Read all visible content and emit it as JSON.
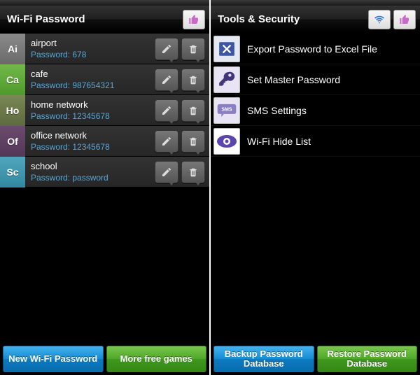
{
  "screen1": {
    "title": "Wi-Fi Password",
    "items": [
      {
        "badge": "Ai",
        "name": "airport",
        "password": "Password: 678",
        "color": "bg-gray"
      },
      {
        "badge": "Ca",
        "name": "cafe",
        "password": "Password: 987654321",
        "color": "bg-green"
      },
      {
        "badge": "Ho",
        "name": "home network",
        "password": "Password: 12345678",
        "color": "bg-olive"
      },
      {
        "badge": "Of",
        "name": "office network",
        "password": "Password: 12345678",
        "color": "bg-purple"
      },
      {
        "badge": "Sc",
        "name": "school",
        "password": "Password: password",
        "color": "bg-cyan"
      }
    ],
    "footer": {
      "left": "New Wi-Fi Password",
      "right": "More free games"
    }
  },
  "screen2": {
    "title": "Tools & Security",
    "items": [
      {
        "label": "Export Password to Excel File",
        "icon": "excel"
      },
      {
        "label": "Set Master Password",
        "icon": "key"
      },
      {
        "label": "SMS Settings",
        "icon": "sms"
      },
      {
        "label": "Wi-Fi Hide List",
        "icon": "eye"
      }
    ],
    "footer": {
      "left": "Backup Password Database",
      "right": "Restore Password Database"
    }
  },
  "colors": {
    "like": "#c868c8",
    "wifi": "#3a76d6"
  }
}
